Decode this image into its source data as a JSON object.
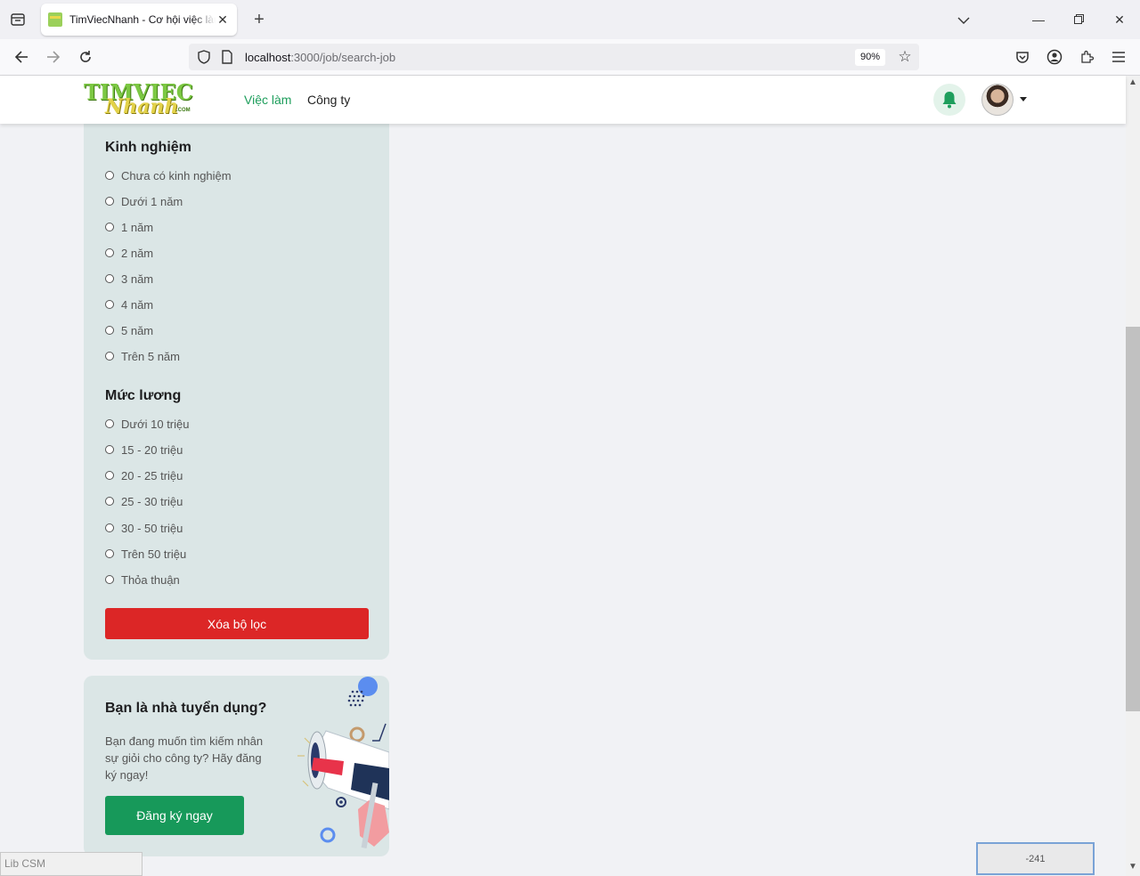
{
  "browser": {
    "tab_title": "TimViecNhanh - Cơ hội việc làm",
    "url_host": "localhost",
    "url_path": ":3000/job/search-job",
    "zoom": "90%"
  },
  "site": {
    "logo": {
      "line1": "TIMVIEC",
      "line2": "Nhanh",
      "line3": ".COM"
    },
    "menu": [
      {
        "label": "Việc làm",
        "active": true
      },
      {
        "label": "Công ty",
        "active": false
      }
    ],
    "accent_color": "#1e9e5c"
  },
  "filters": {
    "experience": {
      "title": "Kinh nghiệm",
      "options": [
        "Chưa có kinh nghiệm",
        "Dưới 1 năm",
        "1 năm",
        "2 năm",
        "3 năm",
        "4 năm",
        "5 năm",
        "Trên 5 năm"
      ]
    },
    "salary": {
      "title": "Mức lương",
      "options": [
        "Dưới 10 triệu",
        "15 - 20 triệu",
        "20 - 25 triệu",
        "25 - 30 triệu",
        "30 - 50 triệu",
        "Trên 50 triệu",
        "Thỏa thuận"
      ]
    },
    "clear_label": "Xóa bộ lọc",
    "clear_color": "#dc2626"
  },
  "recruiter": {
    "title": "Bạn là nhà tuyển dụng?",
    "description": "Bạn đang muốn tìm kiếm nhân sự giỏi cho công ty? Hãy đăng ký ngay!",
    "button_label": "Đăng ký ngay",
    "button_color": "#17995a"
  },
  "overlays": {
    "status_text": "Lib CSM",
    "counter_value": "-241"
  }
}
